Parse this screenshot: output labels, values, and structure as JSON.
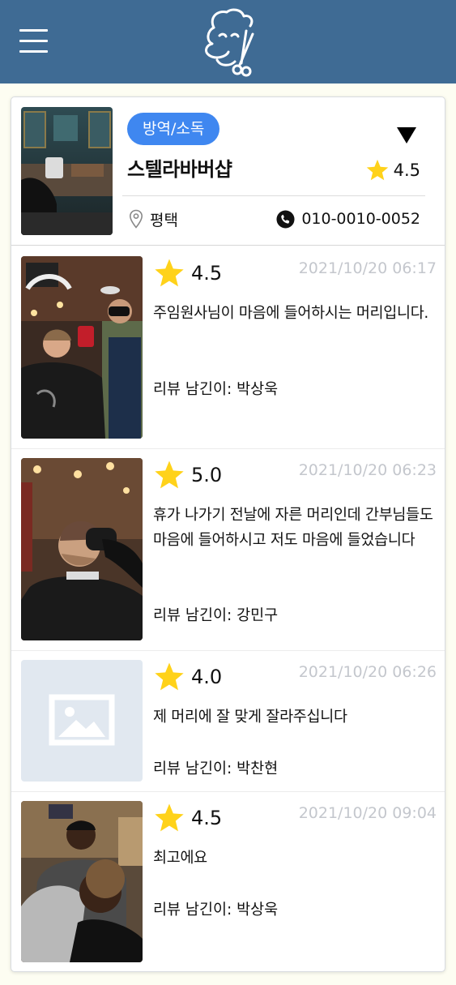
{
  "header": {
    "menu_icon": "hamburger-menu-icon",
    "logo": "barber-face-scissors-logo"
  },
  "shop": {
    "tag": "방역/소독",
    "name": "스텔라바버샵",
    "rating": "4.5",
    "location": "평택",
    "phone": "010-0010-0052"
  },
  "reviews": [
    {
      "rating": "4.5",
      "date": "2021/10/20 06:17",
      "text": "주임원사님이 마음에 들어하시는 머리입니다.",
      "author": "리뷰 남긴이: 박상욱"
    },
    {
      "rating": "5.0",
      "date": "2021/10/20 06:23",
      "text": "휴가 나가기 전날에 자른 머리인데 간부님들도 마음에 들어하시고 저도 마음에 들었습니다",
      "author": "리뷰 남긴이: 강민구"
    },
    {
      "rating": "4.0",
      "date": "2021/10/20 06:26",
      "text": "제 머리에 잘 맞게 잘라주십니다",
      "author": "리뷰 남긴이: 박찬현"
    },
    {
      "rating": "4.5",
      "date": "2021/10/20 09:04",
      "text": "최고에요",
      "author": "리뷰 남긴이: 박상욱"
    }
  ],
  "colors": {
    "header_bg": "#3f6b94",
    "tag_bg": "#3f87f0",
    "star": "#ffd21a",
    "date": "#c4c7cd"
  }
}
